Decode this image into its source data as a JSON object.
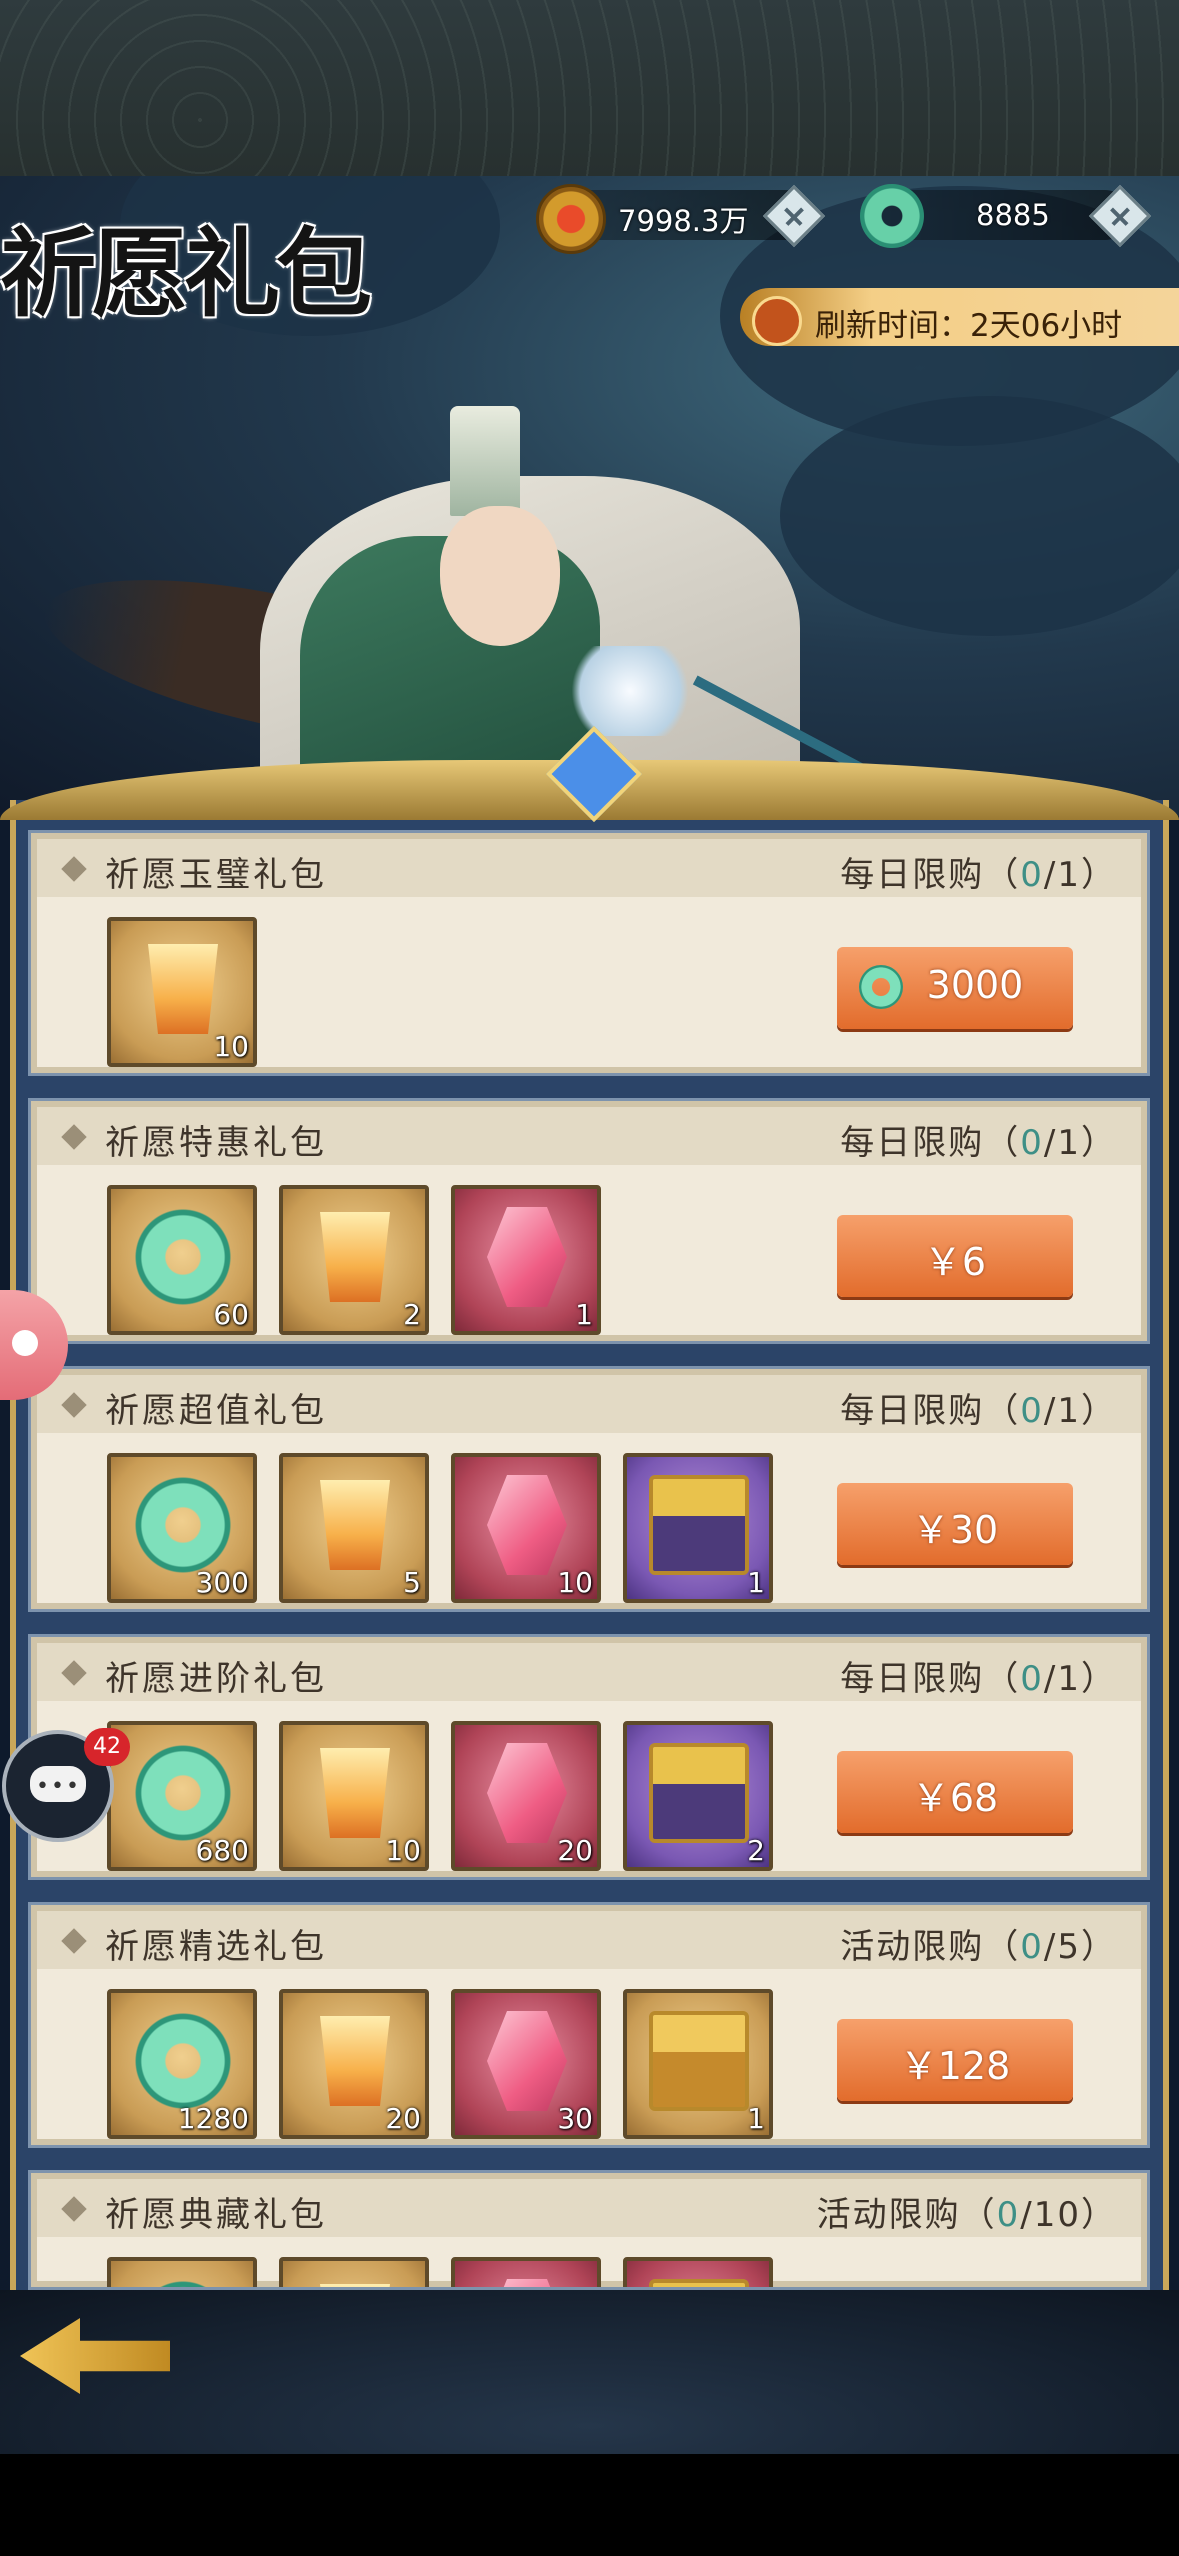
{
  "title": "祈愿礼包",
  "currency": {
    "coins": "7998.3万",
    "jade": "8885"
  },
  "refresh": {
    "label": "刷新时间：2天06小时"
  },
  "packs": [
    {
      "name": "祈愿玉璧礼包",
      "limit_label": "每日限购（",
      "limit_count": "0",
      "limit_total": "/1）",
      "price": "3000",
      "price_type": "jade",
      "items": [
        {
          "icon": "lantern-icon",
          "qty": "10",
          "rarity": "gold"
        }
      ]
    },
    {
      "name": "祈愿特惠礼包",
      "limit_label": "每日限购（",
      "limit_count": "0",
      "limit_total": "/1）",
      "price": "￥6",
      "price_type": "rmb",
      "items": [
        {
          "icon": "jade-ring-icon",
          "qty": "60",
          "rarity": "gold"
        },
        {
          "icon": "lantern-icon",
          "qty": "2",
          "rarity": "gold"
        },
        {
          "icon": "beast-statue-icon",
          "qty": "1",
          "rarity": "red"
        }
      ]
    },
    {
      "name": "祈愿超值礼包",
      "limit_label": "每日限购（",
      "limit_count": "0",
      "limit_total": "/1）",
      "price": "￥30",
      "price_type": "rmb",
      "items": [
        {
          "icon": "jade-ring-icon",
          "qty": "300",
          "rarity": "gold"
        },
        {
          "icon": "lantern-icon",
          "qty": "5",
          "rarity": "gold"
        },
        {
          "icon": "beast-statue-icon",
          "qty": "10",
          "rarity": "red"
        },
        {
          "icon": "treasure-chest-icon",
          "qty": "1",
          "rarity": "purple"
        }
      ]
    },
    {
      "name": "祈愿进阶礼包",
      "limit_label": "每日限购（",
      "limit_count": "0",
      "limit_total": "/1）",
      "price": "￥68",
      "price_type": "rmb",
      "items": [
        {
          "icon": "jade-ring-icon",
          "qty": "680",
          "rarity": "gold"
        },
        {
          "icon": "lantern-icon",
          "qty": "10",
          "rarity": "gold"
        },
        {
          "icon": "beast-statue-icon",
          "qty": "20",
          "rarity": "red"
        },
        {
          "icon": "treasure-chest-icon",
          "qty": "2",
          "rarity": "purple"
        }
      ]
    },
    {
      "name": "祈愿精选礼包",
      "limit_label": "活动限购（",
      "limit_count": "0",
      "limit_total": "/5）",
      "price": "￥128",
      "price_type": "rmb",
      "items": [
        {
          "icon": "jade-ring-icon",
          "qty": "1280",
          "rarity": "gold"
        },
        {
          "icon": "lantern-icon",
          "qty": "20",
          "rarity": "gold"
        },
        {
          "icon": "beast-statue-icon",
          "qty": "30",
          "rarity": "red"
        },
        {
          "icon": "treasure-chest-icon",
          "qty": "1",
          "rarity": "gold"
        }
      ]
    },
    {
      "name": "祈愿典藏礼包",
      "limit_label": "活动限购（",
      "limit_count": "0",
      "limit_total": "/10）",
      "price": "",
      "price_type": "rmb",
      "items": [
        {
          "icon": "jade-ring-icon",
          "qty": "",
          "rarity": "gold"
        },
        {
          "icon": "lantern-icon",
          "qty": "",
          "rarity": "gold"
        },
        {
          "icon": "beast-statue-icon",
          "qty": "",
          "rarity": "red"
        },
        {
          "icon": "treasure-chest-icon",
          "qty": "",
          "rarity": "red"
        }
      ]
    }
  ],
  "chat": {
    "badge": "42"
  }
}
